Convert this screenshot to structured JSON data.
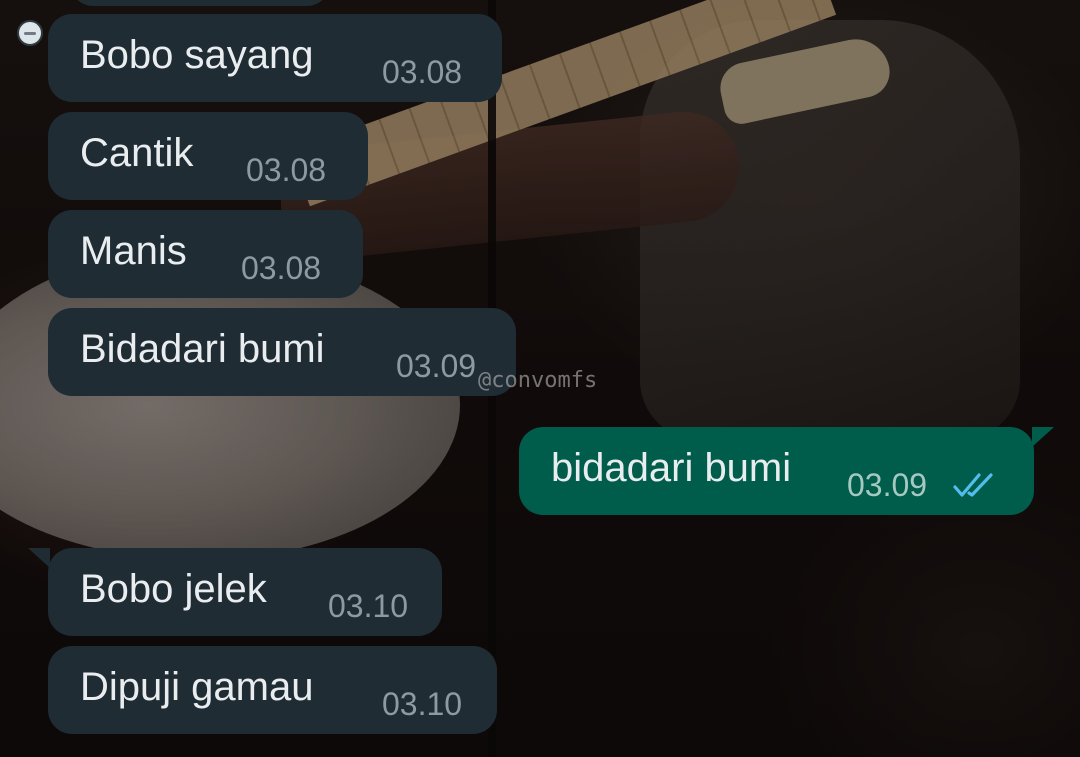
{
  "chat": {
    "watermark": "@convomfs",
    "messages": [
      {
        "direction": "in",
        "text": "Bobo sayang",
        "time": "03.08"
      },
      {
        "direction": "in",
        "text": "Cantik",
        "time": "03.08"
      },
      {
        "direction": "in",
        "text": "Manis",
        "time": "03.08"
      },
      {
        "direction": "in",
        "text": "Bidadari bumi",
        "time": "03.09"
      },
      {
        "direction": "out",
        "text": "bidadari bumi",
        "time": "03.09",
        "status": "read",
        "status_icon": "double-check-icon"
      },
      {
        "direction": "in",
        "text": "Bobo jelek",
        "time": "03.10"
      },
      {
        "direction": "in",
        "text": "Dipuji gamau",
        "time": "03.10"
      }
    ]
  },
  "colors": {
    "incoming_bubble": "#1f2c33",
    "outgoing_bubble": "#005c4b",
    "message_text": "#e9edef",
    "timestamp": "#8d9aa2",
    "read_check": "#53bdeb"
  }
}
